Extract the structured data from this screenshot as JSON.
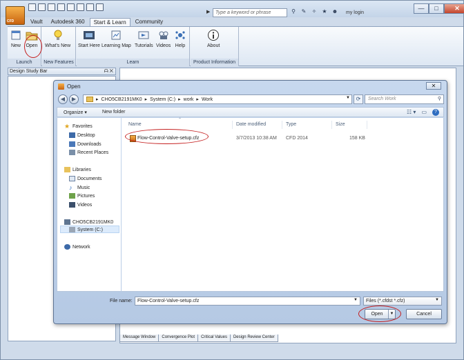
{
  "app": {
    "logo_text": "CFD",
    "search_placeholder": "Type a keyword or phrase",
    "login_label": "my login",
    "window_controls": {
      "minimize": "—",
      "maximize": "□",
      "close": "✕"
    }
  },
  "ribbon": {
    "tabs": [
      "Vault",
      "Autodesk 360",
      "Start & Learn",
      "Community"
    ],
    "active_tab": "Start & Learn",
    "groups": {
      "launch": {
        "label": "Launch",
        "buttons": [
          "New",
          "Open"
        ]
      },
      "new_features": {
        "label": "New Features",
        "buttons": [
          "What's New"
        ]
      },
      "learn": {
        "label": "Learn",
        "buttons": [
          "Start Here",
          "Learning Map",
          "Tutorials",
          "Videos",
          "Help"
        ]
      },
      "product_info": {
        "label": "Product Information",
        "buttons": [
          "About"
        ]
      }
    }
  },
  "design_study_bar": {
    "title": "Design Study Bar",
    "pin": "ᗩ ✕"
  },
  "bottom_tabs": [
    "Message Window",
    "Convergence Plot",
    "Critical Values",
    "Design Review Center"
  ],
  "dialog": {
    "title": "Open",
    "close": "✕",
    "address": {
      "segments": [
        "CHO5CB2191MK0",
        "System (C:)",
        "work",
        "Work"
      ],
      "separator": "▸"
    },
    "search_placeholder": "Search Work",
    "toolbar": {
      "organize": "Organize ▾",
      "new_folder": "New folder"
    },
    "nav": {
      "favorites": "Favorites",
      "desktop": "Desktop",
      "downloads": "Downloads",
      "recent_places": "Recent Places",
      "libraries": "Libraries",
      "documents": "Documents",
      "music": "Music",
      "pictures": "Pictures",
      "videos": "Videos",
      "computer": "CHO5CB2191MK0",
      "system_c": "System (C:)",
      "network": "Network"
    },
    "columns": {
      "name": "Name",
      "date_modified": "Date modified",
      "type": "Type",
      "size": "Size"
    },
    "files": [
      {
        "name": "Flow-Control-Valve-setup.cfz",
        "date_modified": "3/7/2013 10:38 AM",
        "type": "CFD 2014",
        "size": "158 KB"
      }
    ],
    "file_name_label": "File name:",
    "file_name_value": "Flow-Control-Valve-setup.cfz",
    "file_type_value": "Files (*.cfdst *.cfz)",
    "open_label": "Open",
    "cancel_label": "Cancel"
  },
  "colors": {
    "callout": "#c41e1e",
    "window_frame": "#cfdbea",
    "selection": "#dcebfc"
  }
}
